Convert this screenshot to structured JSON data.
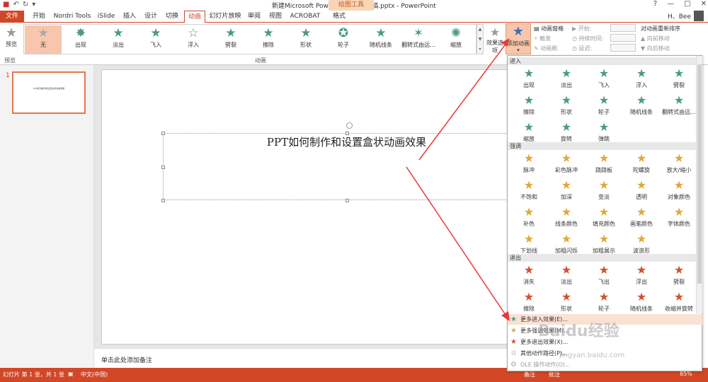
{
  "titlebar": {
    "doc_title": "新建Microsoft PowerPoint 演示文稿.pptx - PowerPoint",
    "context_group": "绘图工具",
    "win_controls": [
      "?",
      "—",
      "□",
      "✕"
    ]
  },
  "tabs": {
    "file": "文件",
    "items": [
      "开始",
      "Nordri Tools",
      "iSlide",
      "插入",
      "设计",
      "切换",
      "动画",
      "幻灯片放映",
      "审阅",
      "视图",
      "ACROBAT",
      "格式"
    ],
    "active": "动画"
  },
  "user": {
    "name": "H、Bee"
  },
  "ribbon": {
    "preview_label": "预览",
    "preview_group": "预览",
    "gallery": [
      "无",
      "出现",
      "淡出",
      "飞入",
      "浮入",
      "劈裂",
      "擦除",
      "形状",
      "轮子",
      "随机线条",
      "翻转式由远...",
      "缩放"
    ],
    "animation_group": "动画",
    "effect_options": "效果选项",
    "add_animation": "添加动画",
    "anim_pane": "动画窗格",
    "trigger": "触发",
    "anim_brush": "动画刷",
    "start": "开始:",
    "duration": "持续时间:",
    "delay": "延迟:",
    "reorder_title": "对动画重新排序",
    "move_earlier": "向前移动",
    "move_later": "向后移动"
  },
  "slide": {
    "number": "1",
    "title": "PPT如何制作和设置盒状动画效果",
    "thumb_title": "PPT如何制作和设置盒状动画效果"
  },
  "notes": {
    "placeholder": "单击此处添加备注"
  },
  "status": {
    "slide_info": "幻灯片 第 1 张，共 1 张",
    "lang": "中文(中国)",
    "notes_btn": "备注",
    "comments_btn": "批注",
    "zoom": "85%"
  },
  "dropdown": {
    "entrance_head": "进入",
    "entrance": [
      "出现",
      "淡出",
      "飞入",
      "浮入",
      "劈裂",
      "擦除",
      "形状",
      "轮子",
      "随机线条",
      "翻转式由远...",
      "缩放",
      "旋转",
      "弹跳"
    ],
    "emphasis_head": "强调",
    "emphasis": [
      "脉冲",
      "彩色脉冲",
      "跷跷板",
      "陀螺旋",
      "放大/缩小",
      "不饱和",
      "加深",
      "变淡",
      "透明",
      "对象颜色",
      "补色",
      "线条颜色",
      "填充颜色",
      "画笔颜色",
      "字体颜色",
      "下划线",
      "加粗闪烁",
      "加粗展示",
      "波浪形"
    ],
    "exit_head": "退出",
    "exit": [
      "消失",
      "淡出",
      "飞出",
      "浮出",
      "劈裂",
      "擦除",
      "形状",
      "轮子",
      "随机线条",
      "收缩并旋转"
    ],
    "more": [
      "更多进入效果(E)...",
      "更多强调效果(M)...",
      "更多退出效果(X)...",
      "其他动作路径(P)...",
      "OLE 操作动作(O)..."
    ]
  },
  "watermark": {
    "brand": "Baidu经验",
    "url": "jingyan.baidu.com"
  },
  "colors": {
    "accent": "#d24726",
    "entrance": "#4a9b7f",
    "emphasis": "#e0a83a",
    "exit": "#d2502f",
    "highlight": "#fbe1d3"
  }
}
